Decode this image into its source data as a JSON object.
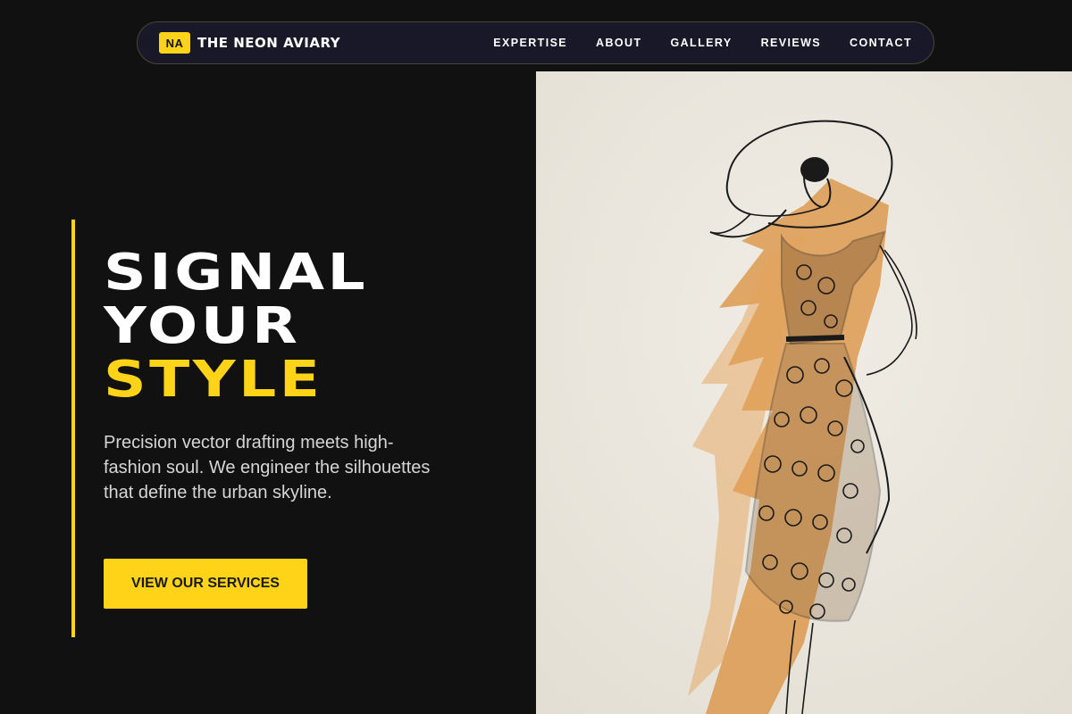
{
  "brand": {
    "badge": "NA",
    "name": "THE NEON AVIARY"
  },
  "nav": {
    "items": [
      {
        "label": "EXPERTISE"
      },
      {
        "label": "ABOUT"
      },
      {
        "label": "GALLERY"
      },
      {
        "label": "REVIEWS"
      },
      {
        "label": "CONTACT"
      }
    ]
  },
  "hero": {
    "headline_line1": "SIGNAL",
    "headline_line2": "YOUR",
    "headline_highlight": "STYLE",
    "lead": "Precision vector drafting meets high-fashion soul. We engineer the silhouettes that define the urban skyline.",
    "cta_label": "VIEW OUR SERVICES",
    "image_subject": "fashion-sketch-dress-illustration"
  },
  "colors": {
    "accent": "#ffd418",
    "background": "#111111",
    "nav_bg": "#181828"
  }
}
